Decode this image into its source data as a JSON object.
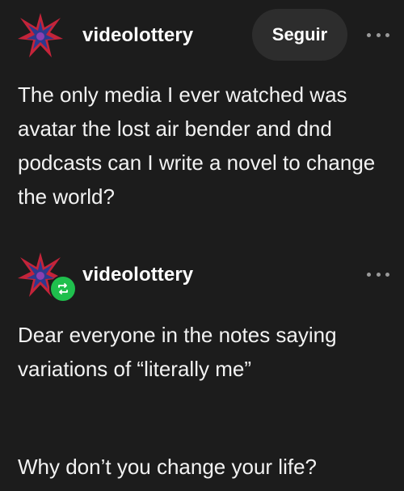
{
  "post": {
    "username": "videolottery",
    "follow_label": "Seguir",
    "body": "The only media I ever watched was avatar the lost air bender and dnd podcasts can I write a novel to change the world?"
  },
  "reblog": {
    "username": "videolottery",
    "body_1": "Dear everyone in the notes saying variations of “literally me”",
    "body_2": "Why don’t you change your life?"
  },
  "colors": {
    "background": "#1c1c1c",
    "follow_button_bg": "#2d2d2d",
    "reblog_badge": "#1fbf4d"
  },
  "icons": {
    "avatar": "star-burst-avatar",
    "menu": "more-dots-icon",
    "reblog": "reblog-icon"
  }
}
